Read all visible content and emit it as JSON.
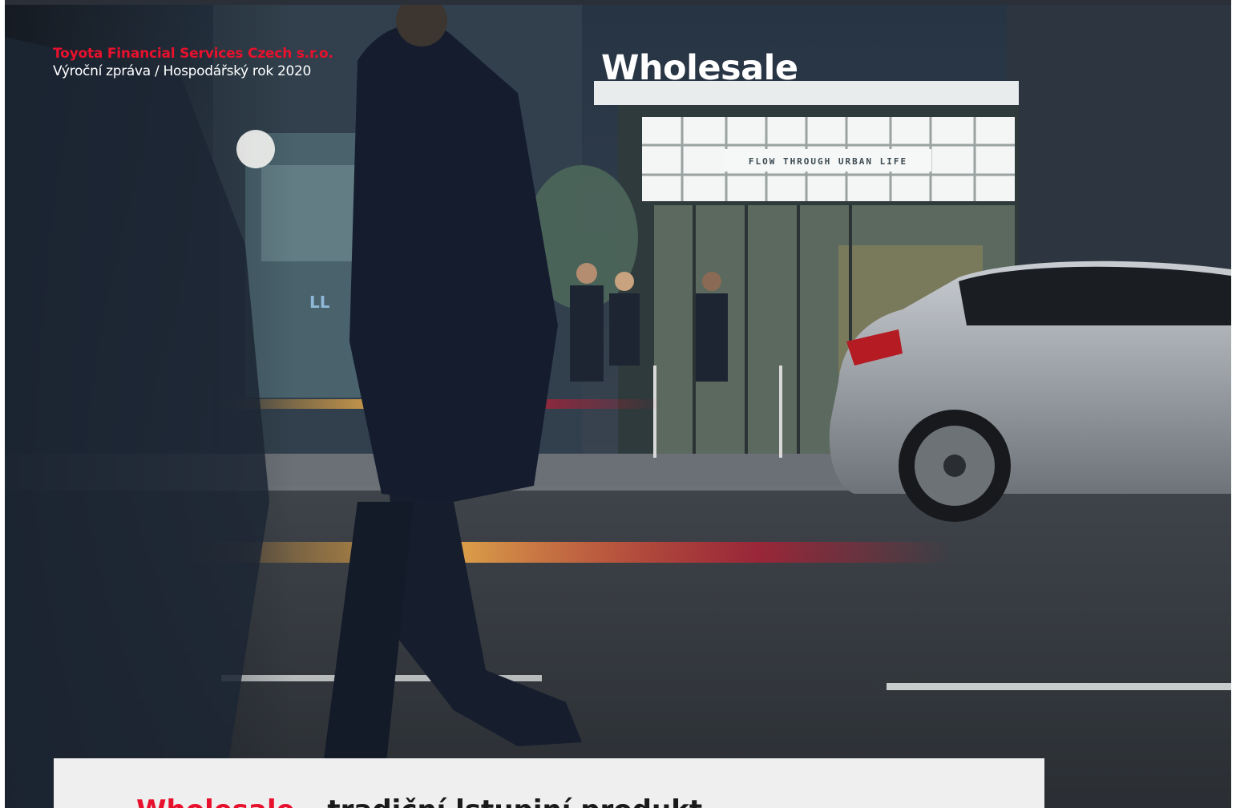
{
  "header": {
    "company": "Toyota Financial Services Czech s.r.o.",
    "report": "Výroční zpráva / Hospodářský rok 2020",
    "section_title": "Wholesale"
  },
  "hero_image": {
    "storefront_sign": "FLOW THROUGH URBAN LIFE",
    "shop_sign": "LL"
  },
  "content": {
    "headline_accent": "Wholesale",
    "headline_rest": " – tradiční lstupiní produkt"
  },
  "colors": {
    "brand_red": "#e8112d",
    "panel_gray": "#efefef"
  }
}
